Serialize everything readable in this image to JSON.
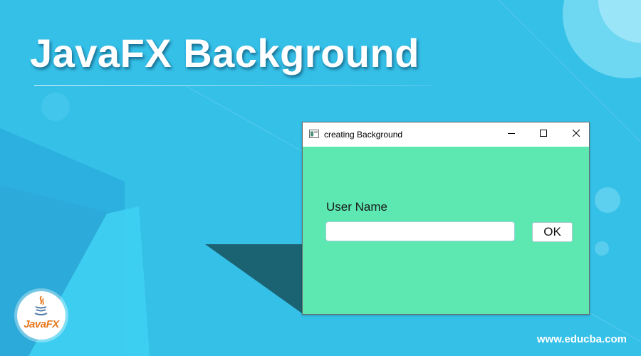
{
  "banner": {
    "title": "JavaFX Background",
    "site": "www.educba.com",
    "logo_text": "JavaFX",
    "logo_icon": "java-cup-icon"
  },
  "window": {
    "title": "creating Background",
    "app_icon": "app-window-icon",
    "controls": {
      "minimize": "minimize-icon",
      "maximize": "maximize-icon",
      "close": "close-icon"
    },
    "label": "User Name",
    "input_value": "",
    "ok_label": "OK"
  },
  "colors": {
    "banner_background": "#35c0e8",
    "window_background": "#5ce8b0",
    "titlebar": "#ffffff",
    "logo_orange": "#e6781e"
  }
}
